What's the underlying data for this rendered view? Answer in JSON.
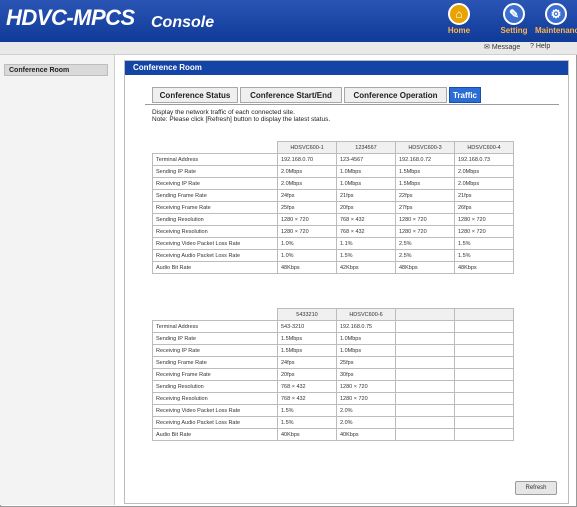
{
  "header": {
    "logo": "HDVC-MPCS",
    "title": "Console",
    "buttons": [
      {
        "label": "Home",
        "icon": "home-icon"
      },
      {
        "label": "Setting",
        "icon": "setting-icon"
      },
      {
        "label": "Maintenance",
        "icon": "maintenance-icon"
      }
    ],
    "sublinks": {
      "message": "Message",
      "help": "Help"
    }
  },
  "sidebar": {
    "items": [
      {
        "label": "Conference Room"
      }
    ]
  },
  "main": {
    "title": "Conference Room",
    "tabs": [
      {
        "label": "Conference Status",
        "active": false
      },
      {
        "label": "Conference Start/End",
        "active": false
      },
      {
        "label": "Conference Operation",
        "active": false
      },
      {
        "label": "Traffic",
        "active": true
      }
    ],
    "note_line1": "Display the network traffic of each connected site.",
    "note_line2": "Note: Please click [Refresh] button to display the latest status.",
    "refresh_label": "Refresh"
  },
  "row_labels": [
    "Terminal Address",
    "Sending IP Rate",
    "Receiving IP Rate",
    "Sending Frame Rate",
    "Receiving Frame Rate",
    "Sending Resolution",
    "Receiving Resolution",
    "Receiving Video Packet Loss Rate",
    "Receiving Audio Packet Loss Rate",
    "Audio Bit Rate"
  ],
  "table1": {
    "columns": [
      "HDSVC600-1",
      "1234567",
      "HDSVC600-3",
      "HDSVC600-4"
    ],
    "rows": [
      [
        "192.168.0.70",
        "123-4567",
        "192.168.0.72",
        "192.168.0.73"
      ],
      [
        "2.0Mbps",
        "1.0Mbps",
        "1.5Mbps",
        "2.0Mbps"
      ],
      [
        "2.0Mbps",
        "1.0Mbps",
        "1.5Mbps",
        "2.0Mbps"
      ],
      [
        "24fps",
        "21fps",
        "22fps",
        "21fps"
      ],
      [
        "25fps",
        "20fps",
        "27fps",
        "26fps"
      ],
      [
        "1280 × 720",
        "768 × 432",
        "1280 × 720",
        "1280 × 720"
      ],
      [
        "1280 × 720",
        "768 × 432",
        "1280 × 720",
        "1280 × 720"
      ],
      [
        "1.0%",
        "1.1%",
        "2.5%",
        "1.5%"
      ],
      [
        "1.0%",
        "1.5%",
        "2.5%",
        "1.5%"
      ],
      [
        "48Kbps",
        "42Kbps",
        "48Kbps",
        "48Kbps"
      ]
    ]
  },
  "table2": {
    "columns": [
      "5433210",
      "HDSVC600-6",
      "",
      ""
    ],
    "rows": [
      [
        "543-3210",
        "192.168.0.75",
        "",
        ""
      ],
      [
        "1.5Mbps",
        "1.0Mbps",
        "",
        ""
      ],
      [
        "1.5Mbps",
        "1.0Mbps",
        "",
        ""
      ],
      [
        "24fps",
        "25fps",
        "",
        ""
      ],
      [
        "20fps",
        "30fps",
        "",
        ""
      ],
      [
        "768 × 432",
        "1280 × 720",
        "",
        ""
      ],
      [
        "768 × 432",
        "1280 × 720",
        "",
        ""
      ],
      [
        "1.5%",
        "2.0%",
        "",
        ""
      ],
      [
        "1.5%",
        "2.0%",
        "",
        ""
      ],
      [
        "40Kbps",
        "40Kbps",
        "",
        ""
      ]
    ]
  }
}
